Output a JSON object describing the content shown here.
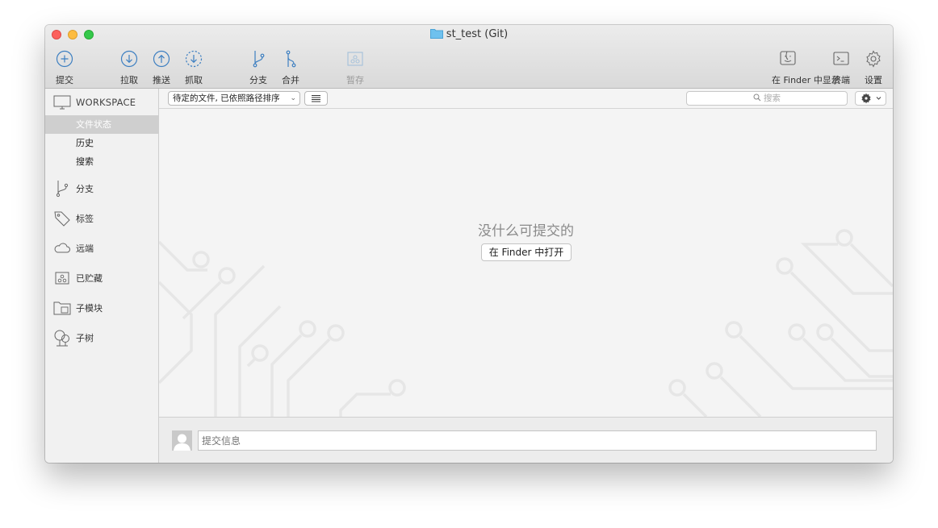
{
  "window": {
    "title": "st_test (Git)"
  },
  "toolbar": {
    "commit": "提交",
    "pull": "拉取",
    "push": "推送",
    "fetch": "抓取",
    "branch": "分支",
    "merge": "合并",
    "stash": "暂存",
    "show_in_finder": "在 Finder 中显示",
    "terminal": "终端",
    "settings": "设置"
  },
  "sidebar": {
    "workspace": "WORKSPACE",
    "workspace_items": [
      "文件状态",
      "历史",
      "搜索"
    ],
    "sections": [
      "分支",
      "标签",
      "远端",
      "已贮藏",
      "子模块",
      "子树"
    ]
  },
  "filterbar": {
    "sort": "待定的文件, 已依照路径排序",
    "search_placeholder": "搜索"
  },
  "main": {
    "empty_text": "没什么可提交的",
    "open_in_finder": "在 Finder 中打开"
  },
  "commit": {
    "message_placeholder": "提交信息"
  }
}
